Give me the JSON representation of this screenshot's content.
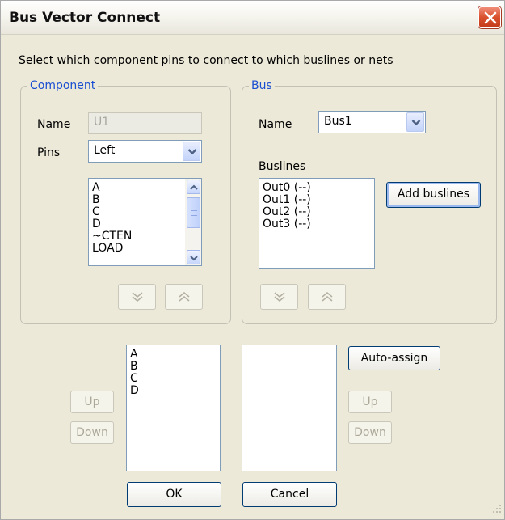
{
  "window": {
    "title": "Bus Vector Connect"
  },
  "instructions": "Select which component pins to connect to which buslines or nets",
  "component": {
    "legend": "Component",
    "name_label": "Name",
    "name_value": "U1",
    "pins_label": "Pins",
    "pins_value": "Left",
    "pin_list": [
      "A",
      "B",
      "C",
      "D",
      "~CTEN",
      "LOAD"
    ]
  },
  "bus": {
    "legend": "Bus",
    "name_label": "Name",
    "name_value": "Bus1",
    "buslines_label": "Buslines",
    "busline_list": [
      "Out0 (--)",
      "Out1 (--)",
      "Out2 (--)",
      "Out3 (--)"
    ],
    "add_buslines_label": "Add buslines"
  },
  "assignments": {
    "selected_pins": [
      "A",
      "B",
      "C",
      "D"
    ],
    "selected_buslines": [],
    "left_up_label": "Up",
    "left_down_label": "Down",
    "auto_assign_label": "Auto-assign",
    "right_up_label": "Up",
    "right_down_label": "Down"
  },
  "footer": {
    "ok_label": "OK",
    "cancel_label": "Cancel"
  }
}
